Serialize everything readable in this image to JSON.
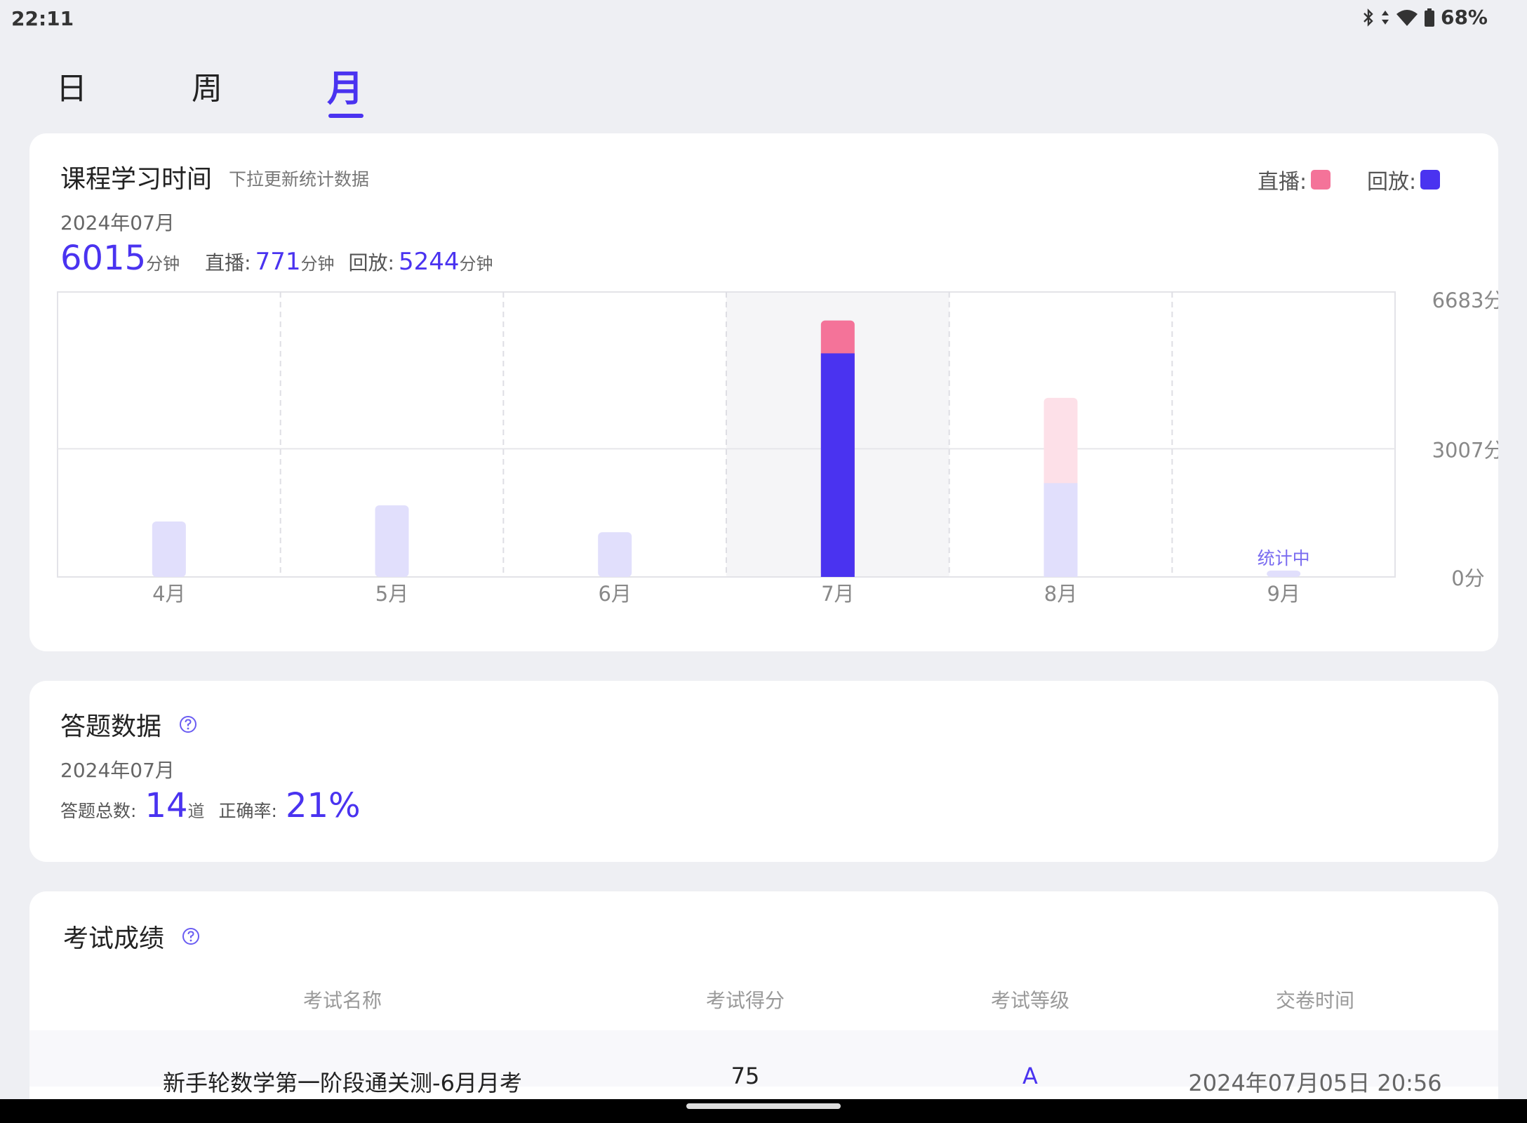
{
  "status": {
    "time": "22:11",
    "battery": "68%"
  },
  "tabs": [
    {
      "label": "日"
    },
    {
      "label": "周"
    },
    {
      "label": "月"
    }
  ],
  "study": {
    "title": "课程学习时间",
    "hint": "下拉更新统计数据",
    "legend_live": "直播:",
    "legend_replay": "回放:",
    "date": "2024年07月",
    "total": "6015",
    "unit": "分钟",
    "live_label": "直播:",
    "live_value": "771",
    "replay_label": "回放:",
    "replay_value": "5244"
  },
  "colors": {
    "accent": "#4a33f0",
    "live": "#f47399",
    "replay": "#4a33f0",
    "live_faded": "#fde0e8",
    "replay_faded": "#e1dffc"
  },
  "chart_data": {
    "type": "bar",
    "stacked": true,
    "categories": [
      "4月",
      "5月",
      "6月",
      "7月",
      "8月",
      "9月"
    ],
    "series": [
      {
        "name": "回放",
        "values": [
          1300,
          1680,
          1050,
          5244,
          2200,
          150
        ]
      },
      {
        "name": "直播",
        "values": [
          0,
          0,
          0,
          771,
          2000,
          0
        ]
      }
    ],
    "selected_category": "7月",
    "y_ticks": [
      "6683分",
      "3007分",
      "0分"
    ],
    "ylim": [
      0,
      6683
    ],
    "annotation": "统计中",
    "grid": true
  },
  "answers": {
    "title": "答题数据",
    "date": "2024年07月",
    "total_label": "答题总数:",
    "total_value": "14",
    "total_unit": "道",
    "accuracy_label": "正确率:",
    "accuracy_value": "21%"
  },
  "exams": {
    "title": "考试成绩",
    "headers": [
      "考试名称",
      "考试得分",
      "考试等级",
      "交卷时间"
    ],
    "rows": [
      [
        "新手轮数学第一阶段通关测-6月月考",
        "75",
        "A",
        "2024年07月05日 20:56"
      ]
    ]
  }
}
